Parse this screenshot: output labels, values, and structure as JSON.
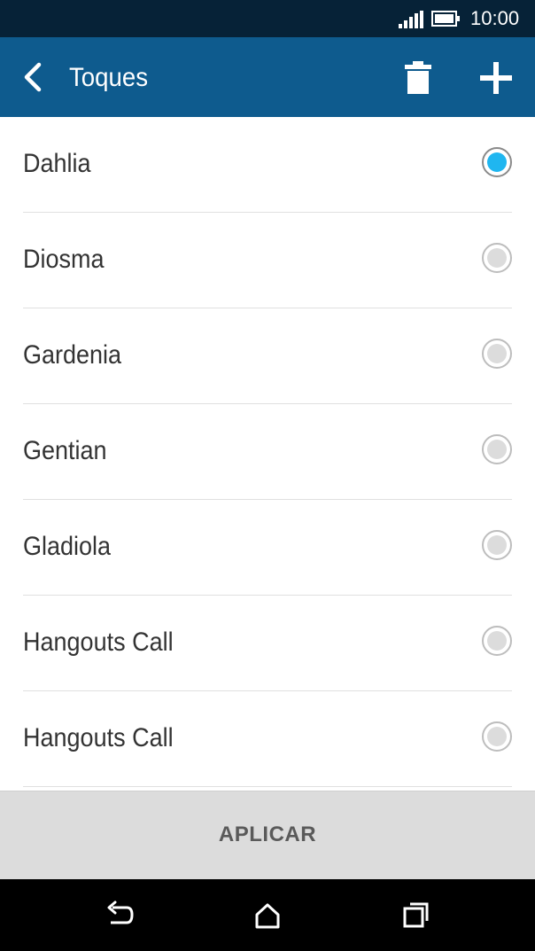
{
  "status_bar": {
    "time": "10:00",
    "icons": [
      "signal-icon",
      "battery-icon"
    ]
  },
  "app_bar": {
    "title": "Toques",
    "background": "#0e5b8e",
    "icons": [
      "back-arrow-icon",
      "trash-icon",
      "plus-icon"
    ]
  },
  "ringtones": {
    "selected_index": 0,
    "accent": "#1fb6f0",
    "items": [
      {
        "label": "Dahlia",
        "selected": true
      },
      {
        "label": "Diosma",
        "selected": false
      },
      {
        "label": "Gardenia",
        "selected": false
      },
      {
        "label": "Gentian",
        "selected": false
      },
      {
        "label": "Gladiola",
        "selected": false
      },
      {
        "label": "Hangouts Call",
        "selected": false
      },
      {
        "label": "Hangouts Call",
        "selected": false
      }
    ]
  },
  "apply_button": {
    "label": "APLICAR"
  },
  "nav_bar": {
    "icons": [
      "back-nav-icon",
      "home-icon",
      "recents-icon"
    ]
  }
}
